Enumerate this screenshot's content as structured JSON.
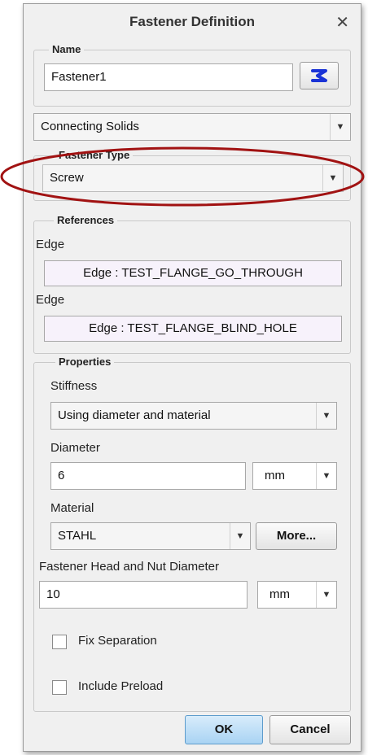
{
  "dialog": {
    "title": "Fastener Definition",
    "close_glyph": "✕"
  },
  "name_group": {
    "legend": "Name",
    "value": "Fastener1"
  },
  "connection": {
    "value": "Connecting Solids"
  },
  "fastener_type": {
    "legend": "Fastener Type",
    "value": "Screw"
  },
  "references": {
    "legend": "References",
    "items": [
      {
        "label": "Edge",
        "value": "Edge : TEST_FLANGE_GO_THROUGH"
      },
      {
        "label": "Edge",
        "value": "Edge : TEST_FLANGE_BLIND_HOLE"
      }
    ]
  },
  "properties": {
    "legend": "Properties",
    "stiffness_label": "Stiffness",
    "stiffness_value": "Using diameter and material",
    "diameter_label": "Diameter",
    "diameter_value": "6",
    "diameter_unit": "mm",
    "material_label": "Material",
    "material_value": "STAHL",
    "more_label": "More...",
    "head_label": "Fastener Head and Nut Diameter",
    "head_value": "10",
    "head_unit": "mm",
    "fix_separation_label": "Fix Separation",
    "include_preload_label": "Include Preload"
  },
  "buttons": {
    "ok": "OK",
    "cancel": "Cancel"
  },
  "icons": {
    "arrow": "▼",
    "select_icon": "select-geometry-icon",
    "select_icon_color": "#1a33d6"
  },
  "colors": {
    "highlight_ellipse": "#a11212"
  }
}
